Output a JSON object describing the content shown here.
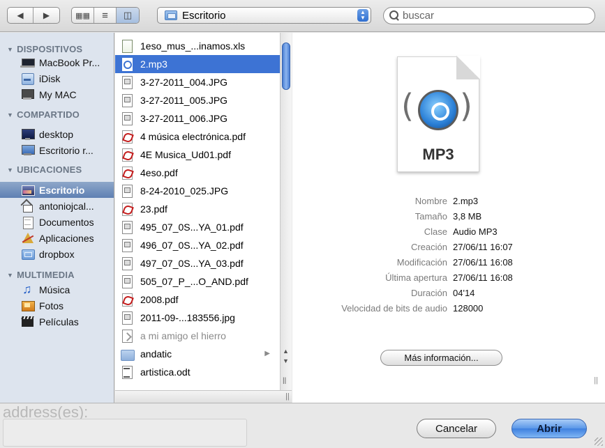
{
  "toolbar": {
    "nav_back_icon": "back-arrow",
    "nav_forward_icon": "forward-arrow",
    "view_icons": [
      "icon-view",
      "list-view",
      "column-view"
    ],
    "location_label": "Escritorio",
    "search_placeholder": "buscar"
  },
  "sidebar": {
    "sections": [
      {
        "title": "DISPOSITIVOS",
        "items": [
          {
            "label": "MacBook Pr...",
            "icon": "laptop-icon"
          },
          {
            "label": "iDisk",
            "icon": "idisk-icon"
          },
          {
            "label": "My MAC",
            "icon": "mac-icon"
          }
        ]
      },
      {
        "title": "COMPARTIDO",
        "items": [
          {
            "label": "desktop",
            "icon": "desktop-icon"
          },
          {
            "label": "Escritorio r...",
            "icon": "monitor-icon"
          }
        ]
      },
      {
        "title": "UBICACIONES",
        "items": [
          {
            "label": "Escritorio",
            "icon": "desktop-folder-icon",
            "selected": true
          },
          {
            "label": "antoniojcal...",
            "icon": "home-icon"
          },
          {
            "label": "Documentos",
            "icon": "documents-icon"
          },
          {
            "label": "Aplicaciones",
            "icon": "applications-icon"
          },
          {
            "label": "dropbox",
            "icon": "folder-icon"
          }
        ]
      },
      {
        "title": "MULTIMEDIA",
        "items": [
          {
            "label": "Música",
            "icon": "music-icon"
          },
          {
            "label": "Fotos",
            "icon": "photos-icon"
          },
          {
            "label": "Películas",
            "icon": "film-icon"
          }
        ]
      }
    ]
  },
  "files": [
    {
      "name": "1eso_mus_...inamos.xls",
      "type": "xls"
    },
    {
      "name": "2.mp3",
      "type": "mp3",
      "selected": true
    },
    {
      "name": "3-27-2011_004.JPG",
      "type": "jpg"
    },
    {
      "name": "3-27-2011_005.JPG",
      "type": "jpg"
    },
    {
      "name": "3-27-2011_006.JPG",
      "type": "jpg"
    },
    {
      "name": "4 música electrónica.pdf",
      "type": "pdf"
    },
    {
      "name": "4E Musica_Ud01.pdf",
      "type": "pdf"
    },
    {
      "name": "4eso.pdf",
      "type": "pdf"
    },
    {
      "name": "8-24-2010_025.JPG",
      "type": "jpg"
    },
    {
      "name": "23.pdf",
      "type": "pdf"
    },
    {
      "name": "495_07_0S...YA_01.pdf",
      "type": "jpg"
    },
    {
      "name": "496_07_0S...YA_02.pdf",
      "type": "jpg"
    },
    {
      "name": "497_07_0S...YA_03.pdf",
      "type": "jpg"
    },
    {
      "name": "505_07_P_...O_AND.pdf",
      "type": "jpg"
    },
    {
      "name": "2008.pdf",
      "type": "pdf"
    },
    {
      "name": "2011-09-...183556.jpg",
      "type": "jpg"
    },
    {
      "name": "a mi amigo el hierro",
      "type": "alias",
      "dim": true
    },
    {
      "name": "andatic",
      "type": "folder",
      "has_children": true
    },
    {
      "name": "artistica.odt",
      "type": "odt"
    }
  ],
  "preview": {
    "format_label": "MP3",
    "info": [
      {
        "key": "Nombre",
        "value": "2.mp3"
      },
      {
        "key": "Tamaño",
        "value": "3,8 MB"
      },
      {
        "key": "Clase",
        "value": "Audio MP3"
      },
      {
        "key": "Creación",
        "value": "27/06/11 16:07"
      },
      {
        "key": "Modificación",
        "value": "27/06/11 16:08"
      },
      {
        "key": "Última apertura",
        "value": "27/06/11 16:08"
      },
      {
        "key": "Duración",
        "value": "04'14"
      },
      {
        "key": "Velocidad de bits de audio",
        "value": "128000"
      }
    ],
    "more_info_label": "Más información..."
  },
  "background_ghost_text": "address(es):",
  "buttons": {
    "cancel": "Cancelar",
    "open": "Abrir"
  }
}
